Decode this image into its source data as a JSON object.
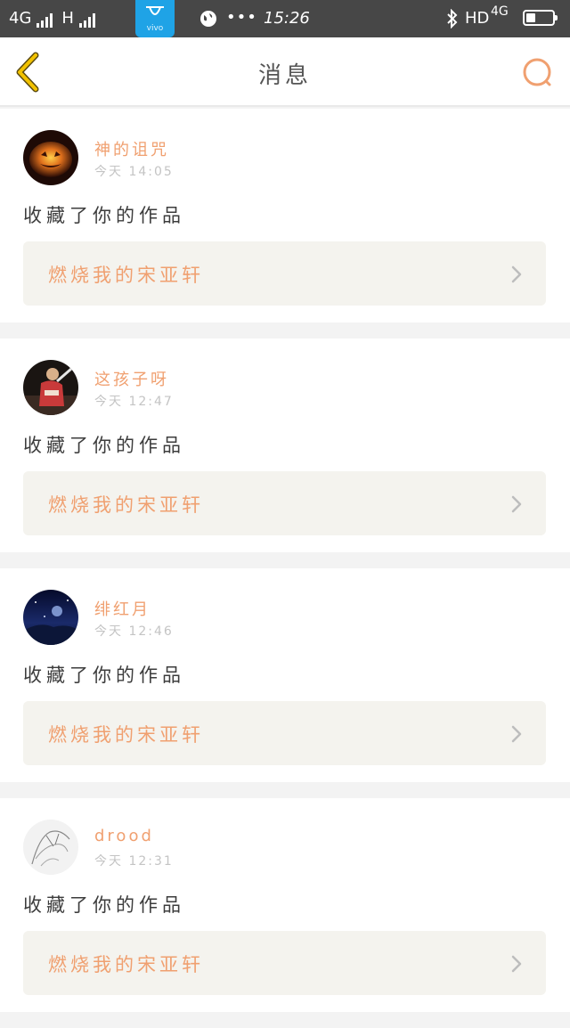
{
  "status_bar": {
    "network_left": "4G",
    "network_h": "H",
    "store_label": "vivo",
    "dots": "•••",
    "time": "15:26",
    "hd": "HD",
    "network_right": "4G",
    "battery_level": 0.35
  },
  "nav": {
    "title": "消息",
    "back_icon": "chevron-left-icon",
    "search_icon": "search-icon"
  },
  "colors": {
    "accent": "#f0a070",
    "back_arrow": "#e8b400",
    "status_bar": "#474747",
    "card_box": "#f4f3ee"
  },
  "messages": [
    {
      "user": "神的诅咒",
      "time": "今天 14:05",
      "action": "收藏了你的作品",
      "work": "燃烧我的宋亚轩",
      "avatar": "pumpkin"
    },
    {
      "user": "这孩子呀",
      "time": "今天 12:47",
      "action": "收藏了你的作品",
      "work": "燃烧我的宋亚轩",
      "avatar": "performer"
    },
    {
      "user": "绯红月",
      "time": "今天 12:46",
      "action": "收藏了你的作品",
      "work": "燃烧我的宋亚轩",
      "avatar": "night-sky"
    },
    {
      "user": "drood",
      "time": "今天 12:31",
      "action": "收藏了你的作品",
      "work": "燃烧我的宋亚轩",
      "avatar": "sketch"
    }
  ]
}
